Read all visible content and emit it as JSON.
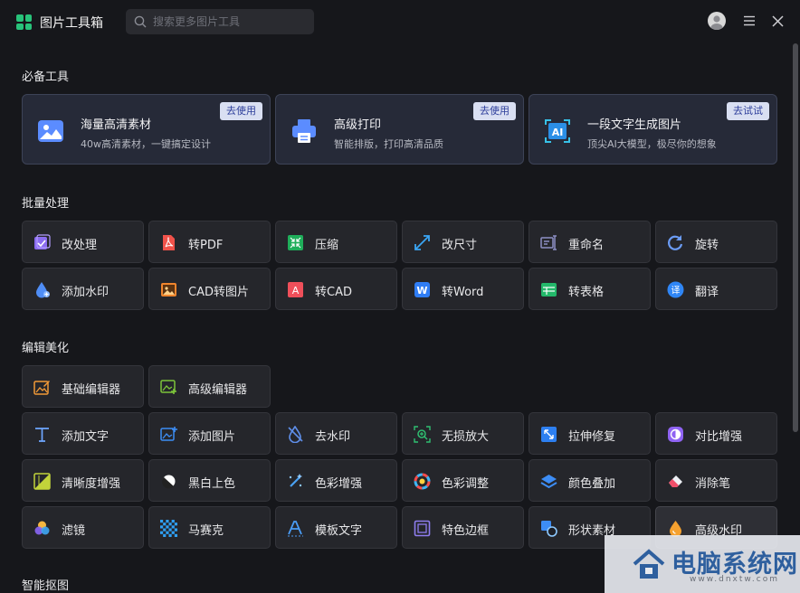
{
  "app": {
    "title": "图片工具箱",
    "search_placeholder": "搜索更多图片工具"
  },
  "sections": {
    "essential": "必备工具",
    "batch": "批量处理",
    "edit": "编辑美化",
    "cutout": "智能抠图"
  },
  "cards": [
    {
      "icon": "image-gallery-icon",
      "title": "海量高清素材",
      "desc": "40w高清素材，一键搞定设计",
      "button": "去使用"
    },
    {
      "icon": "printer-icon",
      "title": "高级打印",
      "desc": "智能排版，打印高清品质",
      "button": "去使用"
    },
    {
      "icon": "ai-image-icon",
      "title": "一段文字生成图片",
      "desc": "顶尖AI大模型，极尽你的想象",
      "button": "去试试"
    }
  ],
  "batch_tools": [
    {
      "icon": "batch-edit-icon",
      "label": "改处理"
    },
    {
      "icon": "pdf-icon",
      "label": "转PDF"
    },
    {
      "icon": "compress-icon",
      "label": "压缩"
    },
    {
      "icon": "resize-icon",
      "label": "改尺寸"
    },
    {
      "icon": "rename-icon",
      "label": "重命名"
    },
    {
      "icon": "rotate-icon",
      "label": "旋转"
    },
    {
      "icon": "watermark-drop-icon",
      "label": "添加水印"
    },
    {
      "icon": "cad-image-icon",
      "label": "CAD转图片"
    },
    {
      "icon": "to-cad-icon",
      "label": "转CAD"
    },
    {
      "icon": "word-icon",
      "label": "转Word"
    },
    {
      "icon": "table-icon",
      "label": "转表格"
    },
    {
      "icon": "translate-icon",
      "label": "翻译"
    }
  ],
  "edit_tools": [
    {
      "icon": "basic-editor-icon",
      "label": "基础编辑器"
    },
    {
      "icon": "advanced-editor-icon",
      "label": "高级编辑器"
    },
    {
      "icon": "text-icon",
      "label": "添加文字"
    },
    {
      "icon": "add-image-icon",
      "label": "添加图片"
    },
    {
      "icon": "remove-watermark-icon",
      "label": "去水印"
    },
    {
      "icon": "lossless-zoom-icon",
      "label": "无损放大"
    },
    {
      "icon": "stretch-repair-icon",
      "label": "拉伸修复"
    },
    {
      "icon": "contrast-icon",
      "label": "对比增强"
    },
    {
      "icon": "sharpness-icon",
      "label": "清晰度增强"
    },
    {
      "icon": "colorize-icon",
      "label": "黑白上色"
    },
    {
      "icon": "color-enhance-icon",
      "label": "色彩增强"
    },
    {
      "icon": "color-adjust-icon",
      "label": "色彩调整"
    },
    {
      "icon": "color-overlay-icon",
      "label": "颜色叠加"
    },
    {
      "icon": "eraser-icon",
      "label": "消除笔"
    },
    {
      "icon": "filter-icon",
      "label": "滤镜"
    },
    {
      "icon": "mosaic-icon",
      "label": "马赛克"
    },
    {
      "icon": "template-text-icon",
      "label": "模板文字"
    },
    {
      "icon": "border-icon",
      "label": "特色边框"
    },
    {
      "icon": "shape-icon",
      "label": "形状素材"
    },
    {
      "icon": "advanced-watermark-icon",
      "label": "高级水印"
    }
  ],
  "watermark": {
    "text": "电脑系统网",
    "url": "www.dnxtw.com"
  },
  "colors": {
    "background": "#16171b",
    "card": "#262a38",
    "tile": "#25262b",
    "button_bg": "#d9dff2",
    "button_text": "#2d3e9b"
  }
}
